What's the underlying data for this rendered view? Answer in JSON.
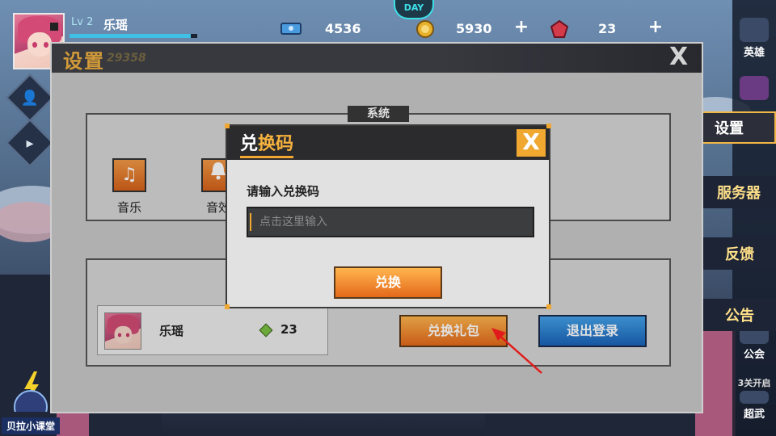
{
  "player": {
    "level": "Lv 2",
    "name": "乐瑶",
    "exp_fraction": 0.95
  },
  "top_badge": {
    "text": "DAY"
  },
  "resources": [
    {
      "icon": "ticket-icon",
      "value": "4536"
    },
    {
      "icon": "gold-coin-icon",
      "value": "5930"
    },
    {
      "icon": "red-gem-icon",
      "value": "23"
    }
  ],
  "settings": {
    "title": "设置",
    "id": "29358",
    "close_label": "X",
    "system_section": "系统",
    "options": [
      {
        "icon": "music-note-icon",
        "glyph": "♫",
        "label": "音乐"
      },
      {
        "icon": "bell-icon",
        "glyph": "🔔",
        "label": "音效"
      }
    ],
    "account": {
      "name": "乐瑶",
      "gems": "23"
    },
    "redeem_gift_button": "兑换礼包",
    "logout_button": "退出登录"
  },
  "redeem_dialog": {
    "title_plain": "兑",
    "title_highlight": "换码",
    "close_label": "X",
    "prompt": "请输入兑换码",
    "input_value": "",
    "input_placeholder": "点击这里输入",
    "confirm_button": "兑换"
  },
  "side_menu": {
    "tabs": [
      {
        "label": "设置"
      },
      {
        "label": "服务器"
      },
      {
        "label": "反馈"
      },
      {
        "label": "公告"
      }
    ],
    "icons": [
      {
        "icon": "hero-icon",
        "label": "英雄"
      },
      {
        "icon": "shop-icon",
        "label": ""
      },
      {
        "icon": "stage-icon",
        "label": "公会"
      },
      {
        "icon": "martial-icon",
        "label": "超武"
      }
    ],
    "unlock_hint": "3关开启"
  },
  "left_panel": {
    "school_label": "贝拉小课堂"
  },
  "colors": {
    "accent_orange": "#f0a830",
    "panel_bg": "#c9c9c9",
    "header_dark": "#2b2b2e",
    "button_blue": "#1a63b8",
    "annotation_red": "#e11b1b"
  }
}
